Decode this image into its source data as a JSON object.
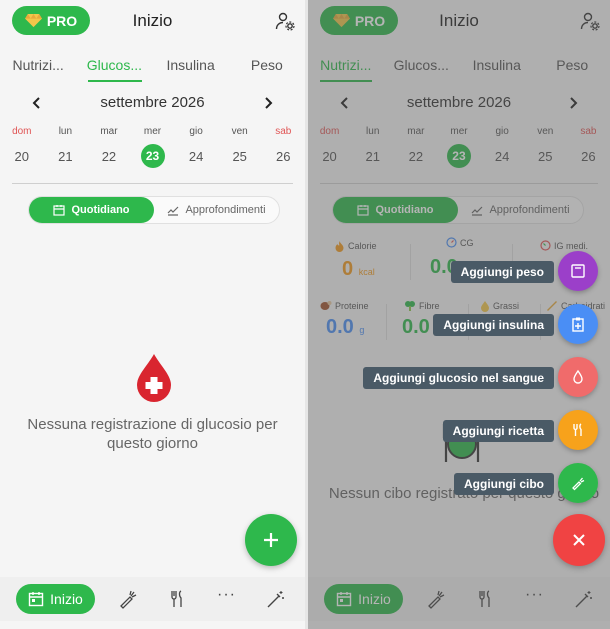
{
  "colors": {
    "accent": "#2eb84c",
    "weekend": "#e05555",
    "blood": "#d9252f",
    "close": "#f04343"
  },
  "header": {
    "pro_label": "PRO",
    "title": "Inizio"
  },
  "tabs": [
    {
      "label": "Nutrizi..."
    },
    {
      "label": "Glucos..."
    },
    {
      "label": "Insulina"
    },
    {
      "label": "Peso"
    }
  ],
  "calendar": {
    "month": "settembre 2026",
    "weekdays": [
      "dom",
      "lun",
      "mar",
      "mer",
      "gio",
      "ven",
      "sab"
    ],
    "days": [
      "20",
      "21",
      "22",
      "23",
      "24",
      "25",
      "26"
    ],
    "selected": "23"
  },
  "segment": {
    "daily": "Quotidiano",
    "insights": "Approfondimenti"
  },
  "glucose_empty": "Nessuna registrazione di glucosio per questo giorno",
  "nav": {
    "home": "Inizio",
    "more": "···"
  },
  "nutrition": {
    "calorie_label": "Calorie",
    "calorie_value": "0",
    "calorie_unit": "kcal",
    "cg_label": "CG",
    "cg_value": "0.0",
    "ig_label": "IG medi.",
    "protein_label": "Proteine",
    "protein_value": "0.0",
    "protein_unit": "g",
    "fiber_label": "Fibre",
    "fiber_value": "0.0",
    "fat_label": "Grassi",
    "carb_label": "Carboidrati",
    "food_empty": "Nessun cibo registrato per questo giorno"
  },
  "actions": [
    {
      "label": "Aggiungi peso",
      "color": "#9b3fc9",
      "icon": "scale-icon"
    },
    {
      "label": "Aggiungi insulina",
      "color": "#4a8ef5",
      "icon": "clipboard-plus-icon"
    },
    {
      "label": "Aggiungi glucosio nel sangue",
      "color": "#f06b6b",
      "icon": "drop-icon"
    },
    {
      "label": "Aggiungi ricetta",
      "color": "#f7a21b",
      "icon": "utensils-icon"
    },
    {
      "label": "Aggiungi cibo",
      "color": "#2eb84c",
      "icon": "carrot-icon"
    }
  ]
}
